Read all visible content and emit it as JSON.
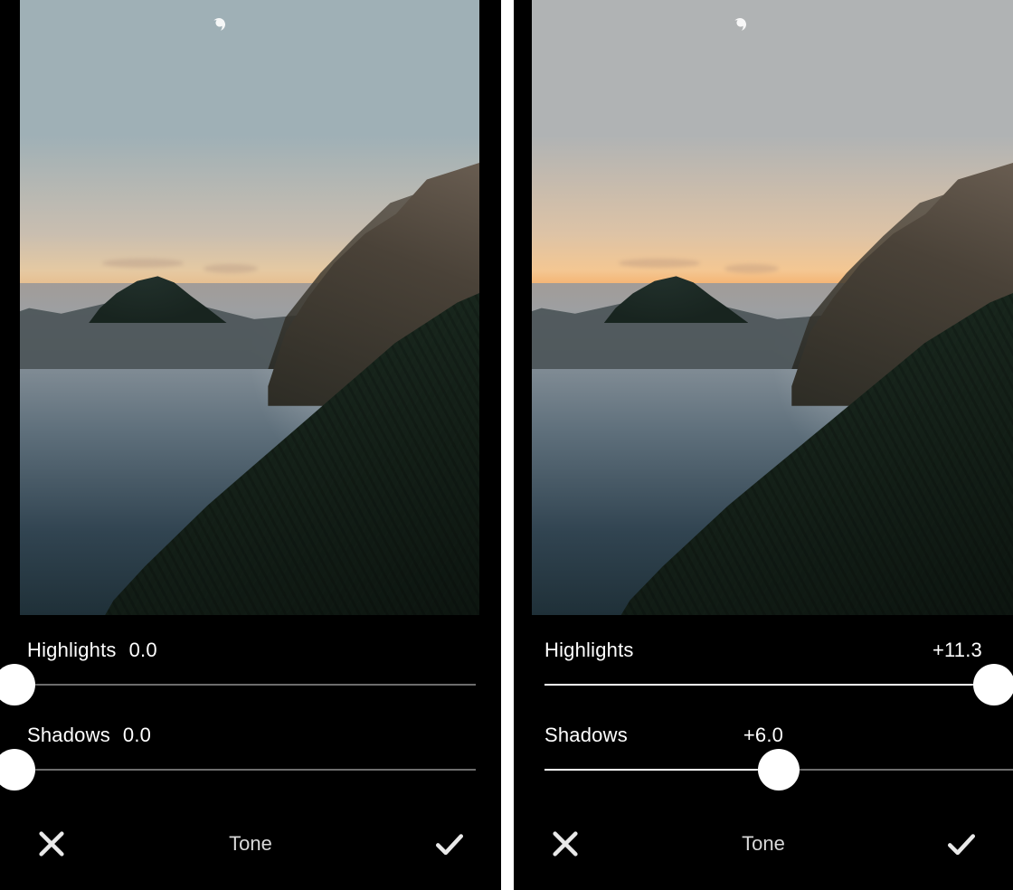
{
  "panels": [
    {
      "id": "before",
      "highlights": {
        "label": "Highlights",
        "value_text": "0.0",
        "percent": 2
      },
      "shadows": {
        "label": "Shadows",
        "value_text": "0.0",
        "percent": 2
      },
      "footer": {
        "title": "Tone"
      },
      "label_layout": {
        "highlights": "inline",
        "shadows": "inline"
      }
    },
    {
      "id": "after",
      "highlights": {
        "label": "Highlights",
        "value_text": "+11.3",
        "percent": 96
      },
      "shadows": {
        "label": "Shadows",
        "value_text": "+6.0",
        "percent": 50
      },
      "footer": {
        "title": "Tone"
      },
      "label_layout": {
        "highlights": "spread",
        "shadows": "valcenter"
      }
    }
  ],
  "icons": {
    "cancel": "close-icon",
    "confirm": "check-icon"
  }
}
